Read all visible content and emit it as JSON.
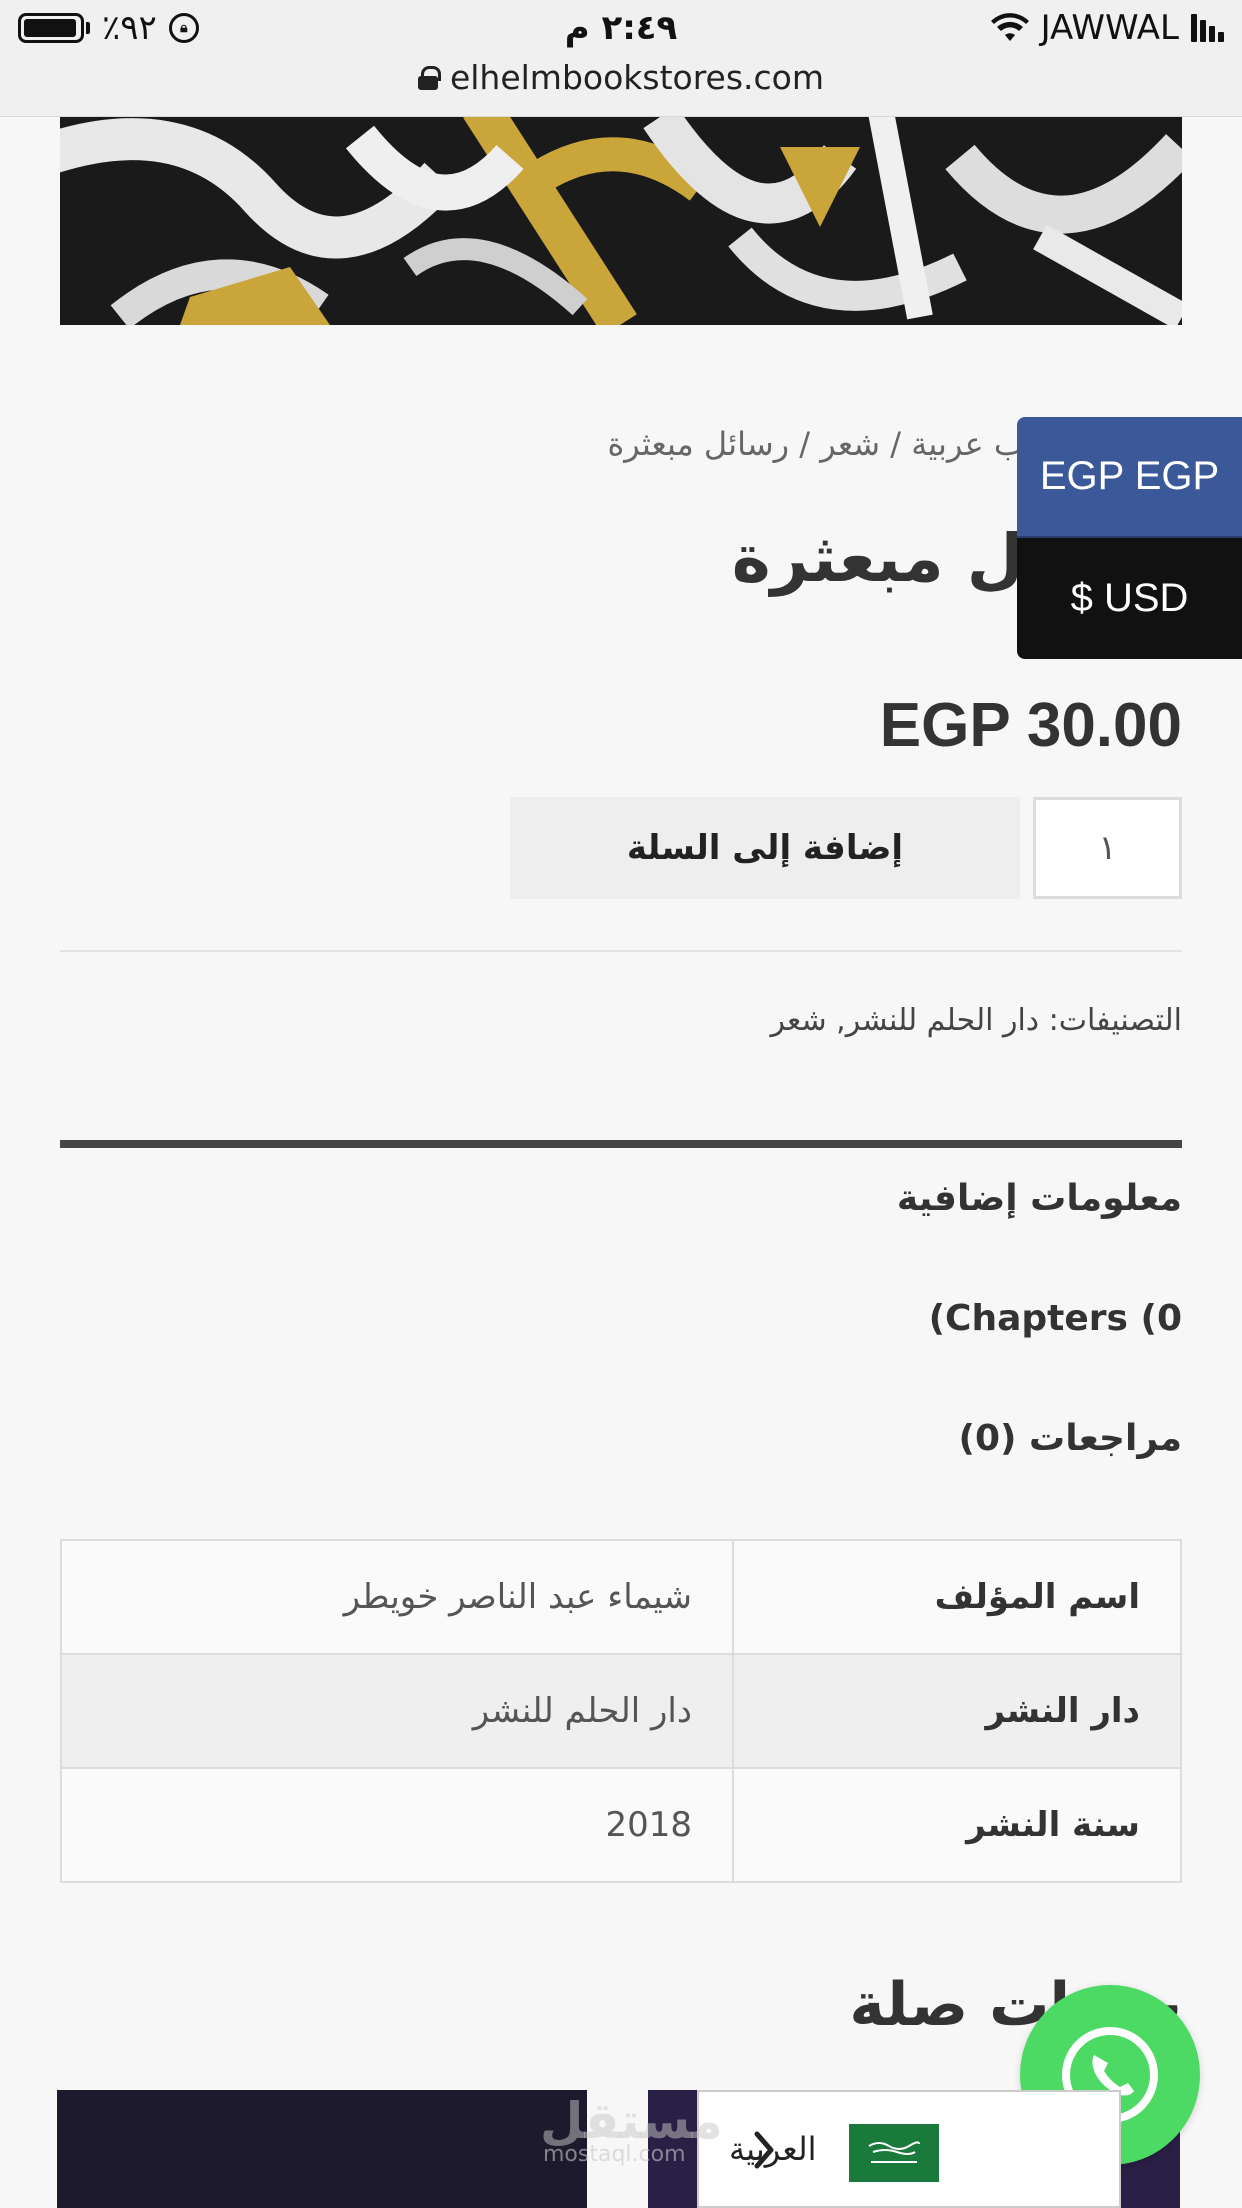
{
  "status_bar": {
    "battery": "٪٩٢",
    "time": "٢:٤٩ م",
    "carrier": "JAWWAL"
  },
  "browser": {
    "url": "elhelmbookstores.com"
  },
  "product": {
    "breadcrumb": "ب عربية / شعر / رسائل مبعثرة",
    "title": "ل مبعثرة",
    "price": "EGP 30.00",
    "quantity": "١",
    "add_to_cart_label": "إضافة إلى السلة",
    "categories": "التصنيفات: دار الحلم للنشر, شعر"
  },
  "tabs": [
    {
      "label": "معلومات إضافية"
    },
    {
      "label": "(Chapters (0"
    },
    {
      "label": "مراجعات (0)"
    }
  ],
  "attributes": [
    {
      "name": "اسم المؤلف",
      "value": "شيماء عبد الناصر خويطر"
    },
    {
      "name": "دار النشر",
      "value": "دار الحلم للنشر"
    },
    {
      "name": "سنة النشر",
      "value": "2018"
    }
  ],
  "related": {
    "title": "ت ذات صلة"
  },
  "currency_switcher": {
    "options": [
      {
        "label": "EGP EGP",
        "color": "#3b5998"
      },
      {
        "label": "$ USD",
        "color": "#111111"
      }
    ]
  },
  "language_switcher": {
    "label": "العربية",
    "flag_icon": "saudi-flag-icon"
  },
  "watermark": {
    "text": "مستقل",
    "sub": "mostaql.com"
  },
  "colors": {
    "whatsapp": "#4cd964",
    "egp_button": "#3b5998",
    "usd_button": "#111111"
  }
}
